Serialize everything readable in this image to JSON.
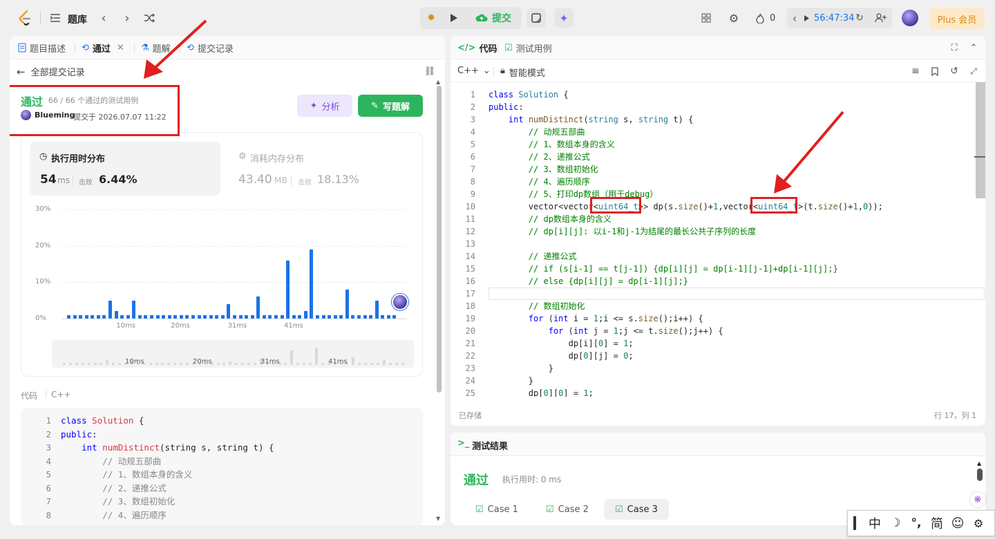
{
  "topbar": {
    "problem_bank": "题库",
    "submit": "提交",
    "fire_count": "0",
    "timer": "56:47:34",
    "plus": "Plus 会员"
  },
  "left": {
    "tabs": [
      "题目描述",
      "通过",
      "题解",
      "提交记录"
    ],
    "back": "全部提交记录",
    "status": "通过",
    "cases": "66 / 66 个通过的测试用例",
    "user": "Blueming",
    "submitted": "提交于 2026.07.07 11:22",
    "analyze": "分析",
    "write": "写题解",
    "time_title": "执行用时分布",
    "time_val": "54",
    "time_unit": "ms",
    "beat_label": "击败",
    "time_beat": "6.44%",
    "mem_title": "消耗内存分布",
    "mem_val": "43.40",
    "mem_unit": "MB",
    "mem_beat": "18.13%",
    "code_label": "代码",
    "lang": "C++"
  },
  "chart_data": {
    "type": "bar",
    "title": "执行用时分布",
    "y_ticks": [
      "30%",
      "20%",
      "10%",
      "0%"
    ],
    "x_ticks": [
      "10ms",
      "20ms",
      "31ms",
      "41ms"
    ],
    "ylim": [
      0,
      30
    ],
    "values": [
      1,
      1,
      1,
      1,
      1,
      1,
      1,
      5,
      2,
      1,
      1,
      5,
      1,
      1,
      1,
      1,
      1,
      1,
      1,
      1,
      1,
      1,
      1,
      1,
      1,
      1,
      1,
      4,
      1,
      1,
      1,
      1,
      6,
      1,
      1,
      1,
      1,
      16,
      1,
      1,
      2,
      19,
      1,
      1,
      1,
      1,
      1,
      8,
      1,
      1,
      1,
      1,
      5,
      1,
      1,
      1
    ]
  },
  "right": {
    "tabs": [
      "代码",
      "测试用例"
    ],
    "lang": "C++",
    "mode": "智能模式",
    "saved": "已存储",
    "cursor": "行 17，列 1",
    "result_title": "测试结果",
    "result_status": "通过",
    "result_time": "执行用时: 0 ms",
    "cases": [
      "Case 1",
      "Case 2",
      "Case 3"
    ]
  },
  "ime": {
    "items": [
      "中",
      "☽",
      "°,",
      "简",
      "☺",
      "⚙"
    ]
  }
}
